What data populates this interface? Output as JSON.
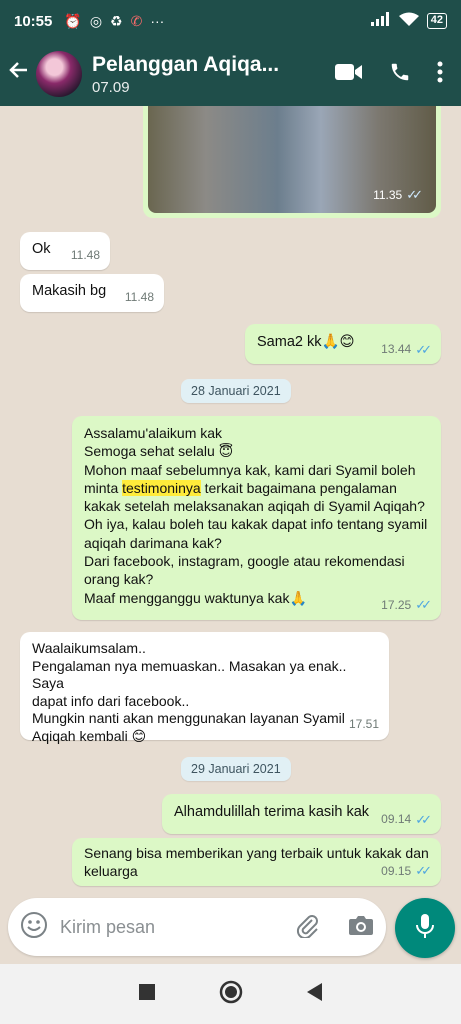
{
  "status_bar": {
    "time": "10:55",
    "battery": "42"
  },
  "header": {
    "name": "Pelanggan Aqiqa...",
    "subtitle": "07.09"
  },
  "messages": [
    {
      "dir": "out",
      "type": "image",
      "time": "11.35",
      "ticks": true
    },
    {
      "dir": "in",
      "text": "Ok",
      "time": "11.48"
    },
    {
      "dir": "in",
      "text": "Makasih bg",
      "time": "11.48"
    },
    {
      "dir": "out",
      "text": "Sama2 kk🙏😊",
      "time": "13.44",
      "ticks": true
    },
    {
      "type": "date",
      "text": "28 Januari 2021"
    },
    {
      "dir": "out",
      "lines": [
        "Assalamu'alaikum  kak",
        "Semoga sehat selalu 😇",
        "Mohon maaf sebelumnya kak, kami dari Syamil boleh",
        "minta |testimoninya| terkait bagaimana pengalaman",
        "kakak setelah melaksanakan aqiqah di Syamil Aqiqah?",
        "Oh iya, kalau boleh tau kakak dapat info tentang syamil",
        "aqiqah darimana kak?",
        "Dari facebook, instagram, google atau rekomendasi",
        "orang kak?",
        "Maaf mengganggu waktunya kak🙏"
      ],
      "time": "17.25",
      "ticks": true
    },
    {
      "dir": "in",
      "lines": [
        "Waalaikumsalam..",
        "Pengalaman nya memuaskan.. Masakan ya enak.. Saya",
        "dapat info dari facebook..",
        "Mungkin nanti akan menggunakan layanan Syamil",
        "Aqiqah kembali 😊"
      ],
      "time": "17.51"
    },
    {
      "type": "date",
      "text": "29 Januari 2021"
    },
    {
      "dir": "out",
      "text": "Alhamdulillah terima kasih kak",
      "time": "09.14",
      "ticks": true
    },
    {
      "dir": "out",
      "lines": [
        "Senang bisa memberikan yang terbaik untuk kakak dan",
        "keluarga"
      ],
      "time": "09.15",
      "ticks": true
    }
  ],
  "highlight_word": "testimoninya",
  "input": {
    "placeholder": "Kirim pesan",
    "value": ""
  },
  "icons": {
    "emoji": "emoji-icon",
    "attach": "paperclip-icon",
    "camera": "camera-icon",
    "mic": "microphone-icon",
    "video": "video-call-icon",
    "call": "phone-icon",
    "menu": "more-vertical-icon"
  },
  "colors": {
    "header": "#1f4e4a",
    "outgoing": "#dcf8c6",
    "incoming": "#ffffff",
    "wallpaper": "#e7ddd2",
    "read_ticks": "#4fa6e0",
    "mic_button": "#00897b"
  }
}
